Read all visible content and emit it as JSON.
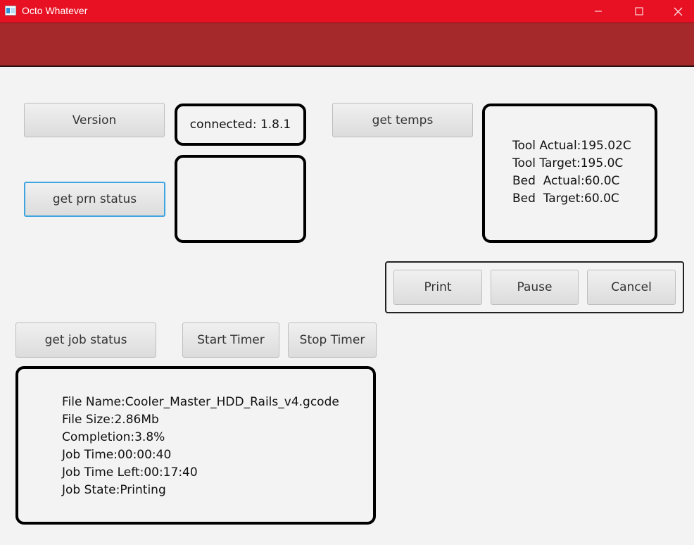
{
  "window": {
    "title": "Octo Whatever"
  },
  "buttons": {
    "version": "Version",
    "get_prn_status": "get prn status",
    "get_temps": "get temps",
    "print": "Print",
    "pause": "Pause",
    "cancel": "Cancel",
    "get_job_status": "get job status",
    "start_timer": "Start Timer",
    "stop_timer": "Stop Timer"
  },
  "version_box": {
    "text": "connected: 1.8.1"
  },
  "prn_status_box": {
    "text": ""
  },
  "temps_box": {
    "lines": [
      "Tool Actual:195.02C",
      "Tool Target:195.0C",
      "Bed  Actual:60.0C",
      "Bed  Target:60.0C"
    ]
  },
  "job_box": {
    "lines": [
      "File Name:Cooler_Master_HDD_Rails_v4.gcode",
      "File Size:2.86Mb",
      "Completion:3.8%",
      "Job Time:00:00:40",
      "Job Time Left:00:17:40",
      "Job State:Printing"
    ]
  },
  "colors": {
    "titlebar": "#e81123",
    "header_band": "#a5292a",
    "focus_ring": "#3da5e0"
  }
}
